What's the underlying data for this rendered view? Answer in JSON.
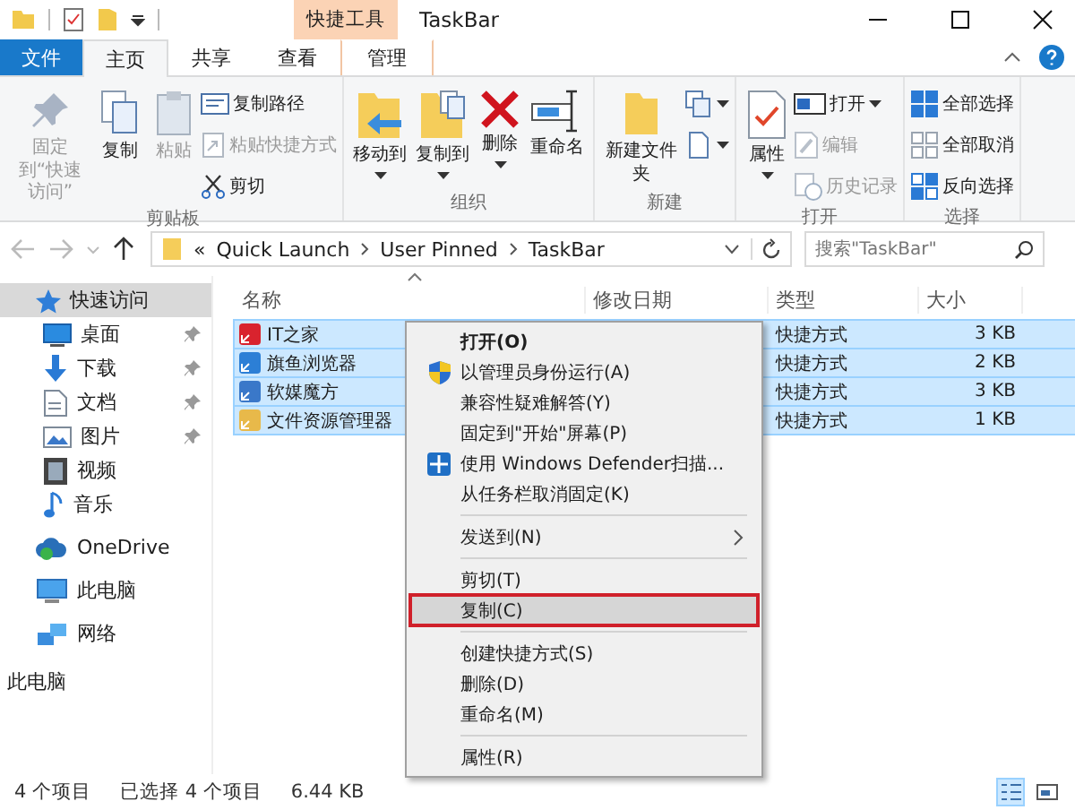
{
  "window": {
    "title": "TaskBar",
    "context_tab": "快捷工具"
  },
  "ribbon_tabs": [
    {
      "label": "文件",
      "kind": "file",
      "selected": false
    },
    {
      "label": "主页",
      "kind": "tab",
      "selected": true
    },
    {
      "label": "共享",
      "kind": "tab",
      "selected": false
    },
    {
      "label": "查看",
      "kind": "tab",
      "selected": false
    },
    {
      "label": "管理",
      "kind": "context",
      "selected": false
    }
  ],
  "ribbon_groups": [
    {
      "label": "剪贴板",
      "items": [
        {
          "label": "固定到“快速访问”",
          "kind": "large",
          "disabled": true,
          "dropdown": false
        },
        {
          "label": "复制",
          "kind": "large",
          "disabled": false,
          "dropdown": false
        },
        {
          "label": "粘贴",
          "kind": "large",
          "disabled": true,
          "dropdown": false
        },
        {
          "label": "复制路径",
          "kind": "small",
          "disabled": false,
          "dropdown": false
        },
        {
          "label": "粘贴快捷方式",
          "kind": "small",
          "disabled": true,
          "dropdown": false
        },
        {
          "label": "剪切",
          "kind": "small",
          "disabled": false,
          "dropdown": false
        }
      ]
    },
    {
      "label": "组织",
      "items": [
        {
          "label": "移动到",
          "kind": "large",
          "disabled": false,
          "dropdown": true
        },
        {
          "label": "复制到",
          "kind": "large",
          "disabled": false,
          "dropdown": true
        },
        {
          "label": "删除",
          "kind": "large",
          "disabled": false,
          "dropdown": true
        },
        {
          "label": "重命名",
          "kind": "large",
          "disabled": false,
          "dropdown": false
        }
      ]
    },
    {
      "label": "新建",
      "items": [
        {
          "label": "新建文件夹",
          "kind": "large",
          "disabled": false,
          "dropdown": false
        },
        {
          "kind": "icon",
          "disabled": false,
          "dropdown": true
        },
        {
          "kind": "icon",
          "disabled": false,
          "dropdown": true
        }
      ]
    },
    {
      "label": "打开",
      "items": [
        {
          "label": "属性",
          "kind": "large",
          "disabled": false,
          "dropdown": true
        },
        {
          "label": "打开",
          "kind": "small",
          "disabled": false,
          "dropdown": true
        },
        {
          "label": "编辑",
          "kind": "small",
          "disabled": true,
          "dropdown": false
        },
        {
          "label": "历史记录",
          "kind": "small",
          "disabled": true,
          "dropdown": false
        }
      ]
    },
    {
      "label": "选择",
      "items": [
        {
          "label": "全部选择",
          "kind": "small",
          "disabled": false,
          "dropdown": false
        },
        {
          "label": "全部取消",
          "kind": "small",
          "disabled": false,
          "dropdown": false
        },
        {
          "label": "反向选择",
          "kind": "small",
          "disabled": false,
          "dropdown": false
        }
      ]
    }
  ],
  "address": {
    "prefix": "«",
    "segments": [
      "Quick Launch",
      "User Pinned",
      "TaskBar"
    ]
  },
  "search": {
    "placeholder": "搜索\"TaskBar\""
  },
  "sidebar": [
    {
      "label": "快速访问",
      "selected": true,
      "children": [
        {
          "label": "桌面",
          "pinned": true
        },
        {
          "label": "下载",
          "pinned": true
        },
        {
          "label": "文档",
          "pinned": true
        },
        {
          "label": "图片",
          "pinned": true
        },
        {
          "label": "视频",
          "pinned": false
        },
        {
          "label": "音乐",
          "pinned": false
        }
      ]
    },
    {
      "label": "OneDrive",
      "selected": false
    },
    {
      "label": "此电脑",
      "selected": false
    },
    {
      "label": "网络",
      "selected": false
    }
  ],
  "sidebar_footer": "此电脑",
  "table": {
    "columns": [
      "名称",
      "修改日期",
      "类型",
      "大小"
    ],
    "rows": [
      {
        "name": "IT之家",
        "type": "快捷方式",
        "size": "3 KB",
        "selected": true
      },
      {
        "name": "旗鱼浏览器",
        "type": "快捷方式",
        "size": "2 KB",
        "selected": true
      },
      {
        "name": "软媒魔方",
        "type": "快捷方式",
        "size": "3 KB",
        "selected": true
      },
      {
        "name": "文件资源管理器",
        "type": "快捷方式",
        "size": "1 KB",
        "selected": true
      }
    ]
  },
  "context_menu": [
    {
      "kind": "item",
      "label": "打开(O)",
      "default": true,
      "selected": false
    },
    {
      "kind": "item",
      "label": "以管理员身份运行(A)",
      "default": false,
      "selected": false
    },
    {
      "kind": "item",
      "label": "兼容性疑难解答(Y)",
      "default": false,
      "selected": false
    },
    {
      "kind": "item",
      "label": "固定到\"开始\"屏幕(P)",
      "default": false,
      "selected": false
    },
    {
      "kind": "item",
      "label": "使用 Windows Defender扫描...",
      "default": false,
      "selected": false
    },
    {
      "kind": "item",
      "label": "从任务栏取消固定(K)",
      "default": false,
      "selected": false
    },
    {
      "kind": "separator"
    },
    {
      "kind": "submenu",
      "label": "发送到(N)",
      "default": false,
      "selected": false
    },
    {
      "kind": "separator"
    },
    {
      "kind": "item",
      "label": "剪切(T)",
      "default": false,
      "selected": false
    },
    {
      "kind": "item",
      "label": "复制(C)",
      "default": false,
      "selected": true
    },
    {
      "kind": "separator"
    },
    {
      "kind": "item",
      "label": "创建快捷方式(S)",
      "default": false,
      "selected": false
    },
    {
      "kind": "item",
      "label": "删除(D)",
      "default": false,
      "selected": false
    },
    {
      "kind": "item",
      "label": "重命名(M)",
      "default": false,
      "selected": false
    },
    {
      "kind": "separator"
    },
    {
      "kind": "item",
      "label": "属性(R)",
      "default": false,
      "selected": false
    }
  ],
  "status_bar": [
    "4 个项目",
    "已选择 4 个项目",
    "6.44 KB"
  ],
  "view_buttons": [
    {
      "selected": true
    },
    {
      "selected": false
    }
  ]
}
